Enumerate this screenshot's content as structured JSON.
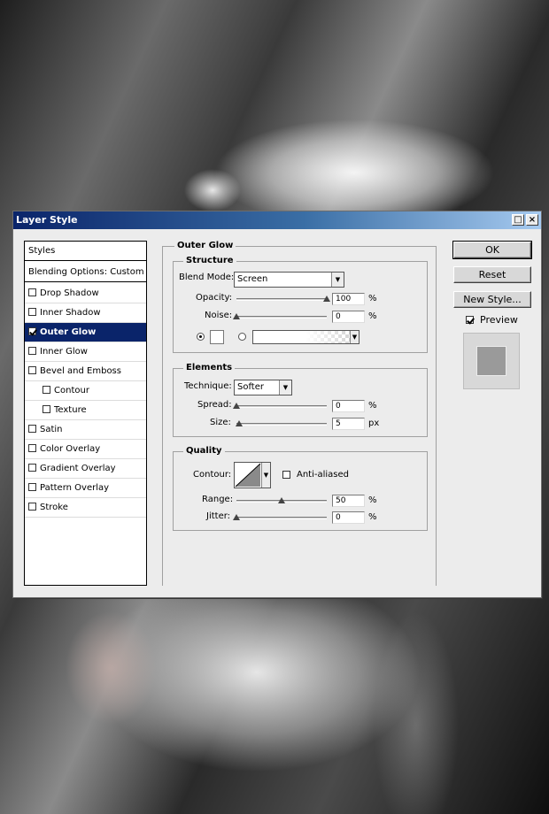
{
  "dialog": {
    "title": "Layer Style"
  },
  "sidebar": {
    "header": "Styles",
    "blending": "Blending Options: Custom",
    "items": [
      {
        "label": "Drop Shadow",
        "checked": false,
        "indent": false
      },
      {
        "label": "Inner Shadow",
        "checked": false,
        "indent": false
      },
      {
        "label": "Outer Glow",
        "checked": true,
        "indent": false,
        "selected": true
      },
      {
        "label": "Inner Glow",
        "checked": false,
        "indent": false
      },
      {
        "label": "Bevel and Emboss",
        "checked": false,
        "indent": false
      },
      {
        "label": "Contour",
        "checked": false,
        "indent": true
      },
      {
        "label": "Texture",
        "checked": false,
        "indent": true
      },
      {
        "label": "Satin",
        "checked": false,
        "indent": false
      },
      {
        "label": "Color Overlay",
        "checked": false,
        "indent": false
      },
      {
        "label": "Gradient Overlay",
        "checked": false,
        "indent": false
      },
      {
        "label": "Pattern Overlay",
        "checked": false,
        "indent": false
      },
      {
        "label": "Stroke",
        "checked": false,
        "indent": false
      }
    ]
  },
  "outer_glow": {
    "title": "Outer Glow",
    "structure": {
      "title": "Structure",
      "blend_mode_label": "Blend Mode:",
      "blend_mode_value": "Screen",
      "opacity_label": "Opacity:",
      "opacity_value": "100",
      "opacity_fraction": 1.0,
      "noise_label": "Noise:",
      "noise_value": "0",
      "noise_fraction": 0.0,
      "percent": "%"
    },
    "elements": {
      "title": "Elements",
      "technique_label": "Technique:",
      "technique_value": "Softer",
      "spread_label": "Spread:",
      "spread_value": "0",
      "spread_fraction": 0.0,
      "size_label": "Size:",
      "size_value": "5",
      "size_fraction": 0.03,
      "percent": "%",
      "px": "px"
    },
    "quality": {
      "title": "Quality",
      "contour_label": "Contour:",
      "antialiased_label": "Anti-aliased",
      "antialiased": false,
      "range_label": "Range:",
      "range_value": "50",
      "range_fraction": 0.5,
      "jitter_label": "Jitter:",
      "jitter_value": "0",
      "jitter_fraction": 0.0,
      "percent": "%"
    }
  },
  "buttons": {
    "ok": "OK",
    "reset": "Reset",
    "new_style": "New Style..."
  },
  "preview": {
    "label": "Preview",
    "checked": true
  },
  "colors": {
    "title_start": "#0a246a",
    "title_end": "#a6caf0",
    "selection": "#0a246a"
  }
}
